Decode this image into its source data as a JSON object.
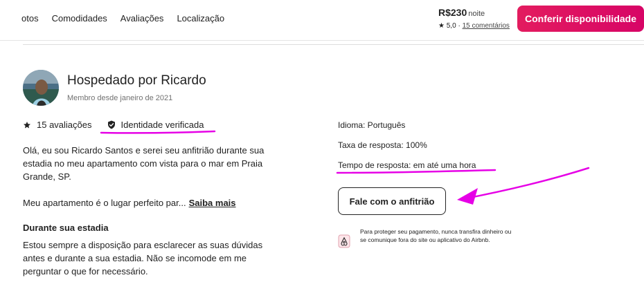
{
  "nav": {
    "items": [
      "Fotos",
      "Comodidades",
      "Avaliações",
      "Localização"
    ],
    "first_visible": "otos"
  },
  "booking": {
    "price": "R$230",
    "per": "noite",
    "rating": "5,0",
    "separator": "·",
    "reviews": "15 comentários",
    "cta": "Conferir disponibilidade",
    "accent": "#e31c5f"
  },
  "host": {
    "title": "Hospedado por Ricardo",
    "member_since": "Membro desde janeiro de 2021",
    "reviews_count": "15 avaliações",
    "identity": "Identidade verificada",
    "bio": "Olá, eu sou Ricardo Santos e serei seu anfitrião durante sua estadia no meu apartamento com vista para o mar em Praia Grande, SP.",
    "bio_more_text": "Meu apartamento é o lugar perfeito par...",
    "bio_more_link": "Saiba mais",
    "stay_title": "Durante sua estadia",
    "stay_text": "Estou sempre a disposição para esclarecer as suas dúvidas antes e durante a sua estadia. Não se incomode em me perguntar o que for necessário."
  },
  "details": {
    "language": "Idioma: Português",
    "response_rate": "Taxa de resposta: 100%",
    "response_time": "Tempo de resposta: em até uma hora",
    "contact_button": "Fale com o anfitrião",
    "protect_text": "Para proteger seu pagamento, nunca transfira dinheiro ou se comunique fora do site ou aplicativo do Airbnb."
  },
  "annotations": {
    "color": "#e600e6"
  },
  "icons": [
    "star-icon",
    "shield-check-icon",
    "airbnb-logo-icon",
    "avatar-photo"
  ]
}
